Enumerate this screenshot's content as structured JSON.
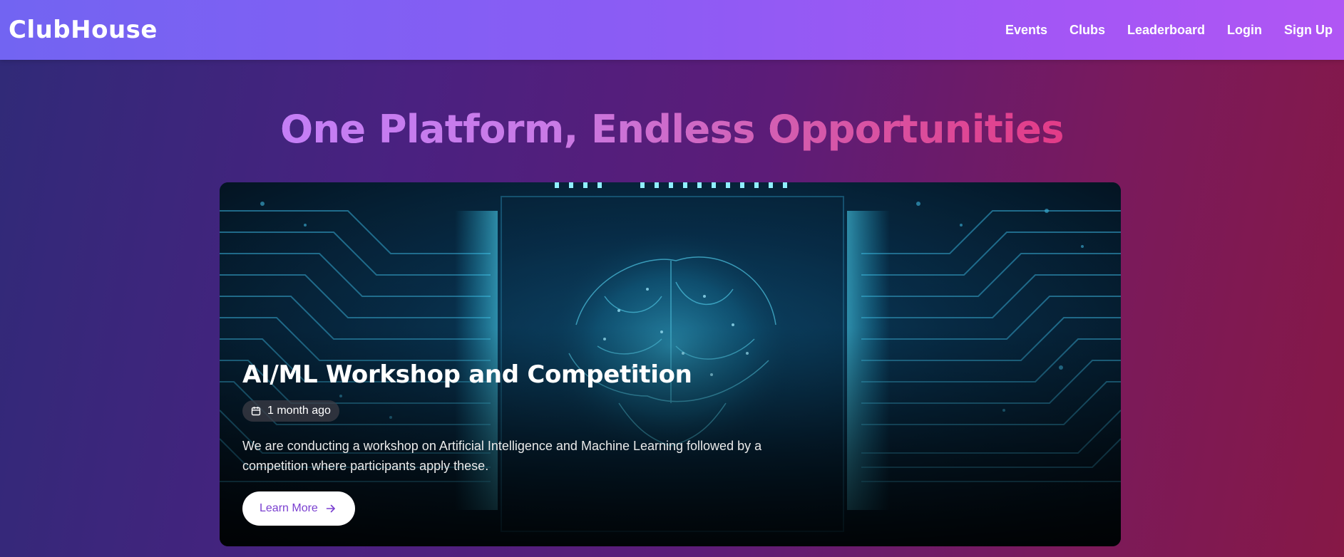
{
  "header": {
    "logo": "ClubHouse",
    "nav": [
      {
        "label": "Events"
      },
      {
        "label": "Clubs"
      },
      {
        "label": "Leaderboard"
      },
      {
        "label": "Login"
      },
      {
        "label": "Sign Up"
      }
    ]
  },
  "hero": {
    "title": "One Platform, Endless Opportunities"
  },
  "featured_event": {
    "title": "AI/ML Workshop and Competition",
    "date": "1 month ago",
    "date_icon": "calendar-icon",
    "description": "We are conducting a workshop on Artificial Intelligence and Machine Learning followed by a competition where participants apply these.",
    "button_label": "Learn More",
    "button_icon": "arrow-right-icon"
  },
  "colors": {
    "nav_gradient_start": "#7264f2",
    "nav_gradient_end": "#b056f4",
    "title_gradient_start": "#c47ef6",
    "title_gradient_end": "#e33b87",
    "button_text": "#7a3fd0"
  }
}
